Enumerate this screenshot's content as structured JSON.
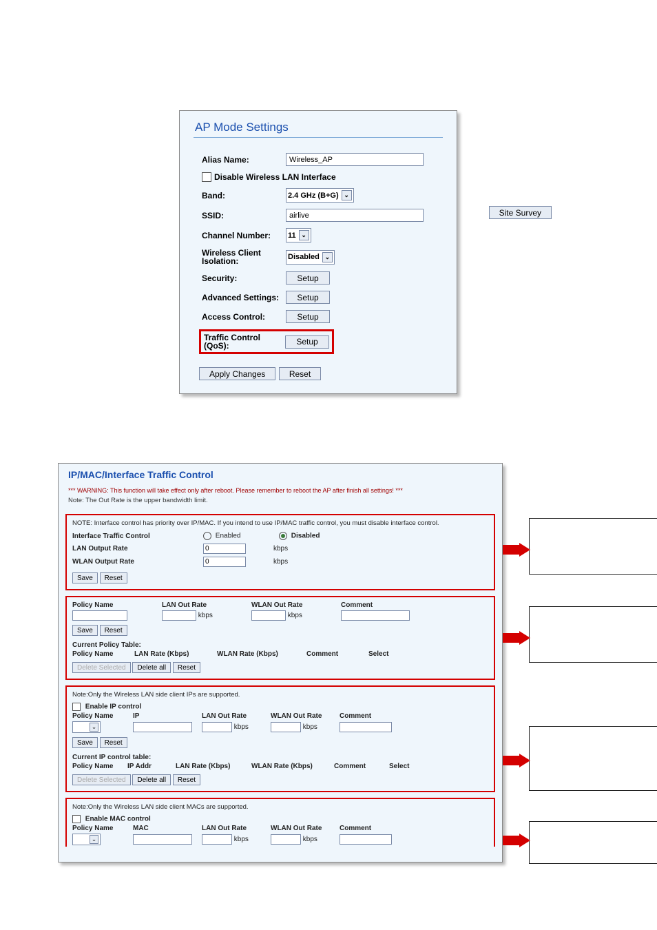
{
  "ap": {
    "title": "AP Mode Settings",
    "labels": {
      "alias": "Alias Name:",
      "disable": "Disable Wireless LAN Interface",
      "band": "Band:",
      "ssid": "SSID:",
      "channel": "Channel Number:",
      "isolation": "Wireless Client Isolation:",
      "security": "Security:",
      "advanced": "Advanced Settings:",
      "access": "Access Control:",
      "qos": "Traffic Control (QoS):"
    },
    "values": {
      "alias": "Wireless_AP",
      "band": "2.4 GHz (B+G)",
      "ssid": "airlive",
      "channel": "11",
      "isolation": "Disabled"
    },
    "buttons": {
      "setup": "Setup",
      "site_survey": "Site Survey",
      "apply": "Apply Changes",
      "reset": "Reset"
    }
  },
  "tc": {
    "title": "IP/MAC/Interface Traffic Control",
    "warning": "*** WARNING: This function will take effect only after reboot. Please remember to reboot the AP after finish all settings! ***",
    "note_outrate": "Note: The Out Rate is the upper bandwidth limit.",
    "section1": {
      "note": "NOTE: Interface control has priority over IP/MAC. If you intend to use IP/MAC traffic control, you must disable interface control.",
      "interface_label": "Interface Traffic Control",
      "enabled": "Enabled",
      "disabled": "Disabled",
      "lan_label": "LAN Output Rate",
      "wlan_label": "WLAN Output Rate",
      "zero": "0",
      "kbps": "kbps",
      "save": "Save",
      "reset": "Reset"
    },
    "section2": {
      "h_policy": "Policy Name",
      "h_lan": "LAN Out Rate",
      "h_wlan": "WLAN Out Rate",
      "h_comment": "Comment",
      "kbps": "kbps",
      "save": "Save",
      "reset": "Reset",
      "cur_title": "Current Policy Table:",
      "t_policy": "Policy Name",
      "t_lan": "LAN Rate (Kbps)",
      "t_wlan": "WLAN Rate (Kbps)",
      "t_comment": "Comment",
      "t_select": "Select",
      "del_sel": "Delete Selected",
      "del_all": "Delete all",
      "reset2": "Reset"
    },
    "section3": {
      "note": "Note:Only the Wireless LAN side client IPs are supported.",
      "enable": "Enable IP control",
      "h_policy": "Policy Name",
      "h_ip": "IP",
      "h_lan": "LAN Out Rate",
      "h_wlan": "WLAN Out Rate",
      "h_comment": "Comment",
      "kbps": "kbps",
      "save": "Save",
      "reset": "Reset",
      "cur_title": "Current IP control table:",
      "t_policy": "Policy Name",
      "t_ip": "IP Addr",
      "t_lan": "LAN Rate (Kbps)",
      "t_wlan": "WLAN Rate (Kbps)",
      "t_comment": "Comment",
      "t_select": "Select",
      "del_sel": "Delete Selected",
      "del_all": "Delete all",
      "reset2": "Reset"
    },
    "section4": {
      "note": "Note:Only the Wireless LAN side client MACs are supported.",
      "enable": "Enable MAC control",
      "h_policy": "Policy Name",
      "h_mac": "MAC",
      "h_lan": "LAN Out Rate",
      "h_wlan": "WLAN Out Rate",
      "h_comment": "Comment",
      "kbps": "kbps"
    }
  }
}
